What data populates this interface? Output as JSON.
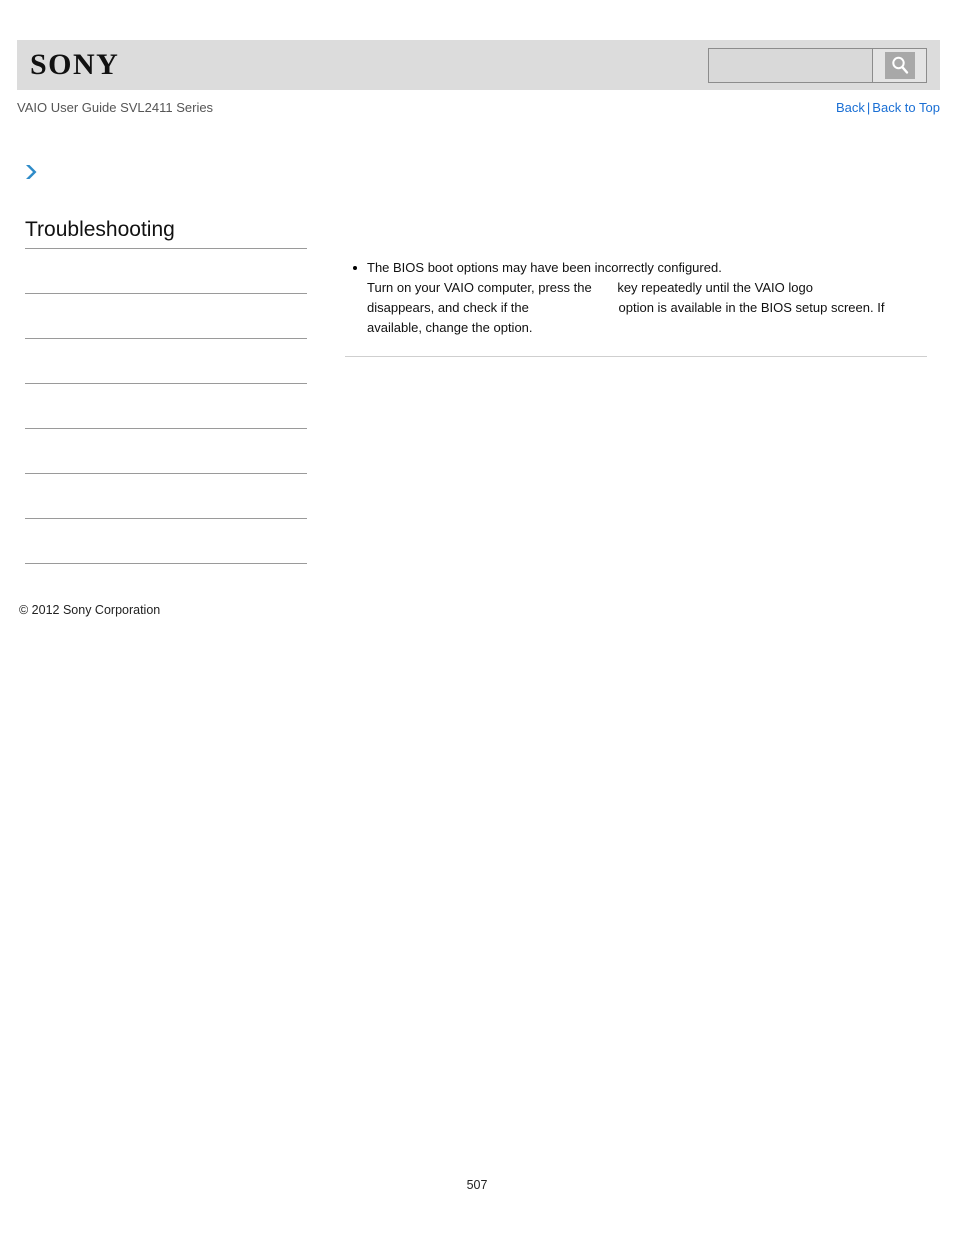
{
  "header": {
    "logo_text": "SONY",
    "search": {
      "value": "",
      "placeholder": "",
      "icon": "search-icon",
      "button_label": ""
    },
    "band_color": "#dcdcdc"
  },
  "sub_header": {
    "guide_title": "VAIO User Guide SVL2411 Series",
    "links": [
      {
        "label": "Back"
      },
      {
        "label": "Back to Top"
      }
    ],
    "separator": "|",
    "link_color": "#1a6fd4"
  },
  "breadcrumb": {
    "icon": "chevron-right-icon",
    "icon_color": "#2e8bc8",
    "label": ""
  },
  "sidebar": {
    "title": "Troubleshooting",
    "items": [
      {
        "label": ""
      },
      {
        "label": ""
      },
      {
        "label": ""
      },
      {
        "label": ""
      },
      {
        "label": ""
      },
      {
        "label": ""
      },
      {
        "label": ""
      }
    ]
  },
  "main": {
    "bullets": [
      {
        "line1": "The BIOS boot options may have been incorrectly configured.",
        "line2_a": "Turn on your VAIO computer, press the",
        "line2_key": "",
        "line2_b": "key repeatedly until the VAIO logo",
        "line3_a": "disappears, and check if the",
        "line3_option": "",
        "line3_b": "option is available in the BIOS setup screen. If",
        "line4": "available, change the option."
      }
    ]
  },
  "footer": {
    "copyright": "© 2012 Sony Corporation",
    "page_number": "507"
  }
}
